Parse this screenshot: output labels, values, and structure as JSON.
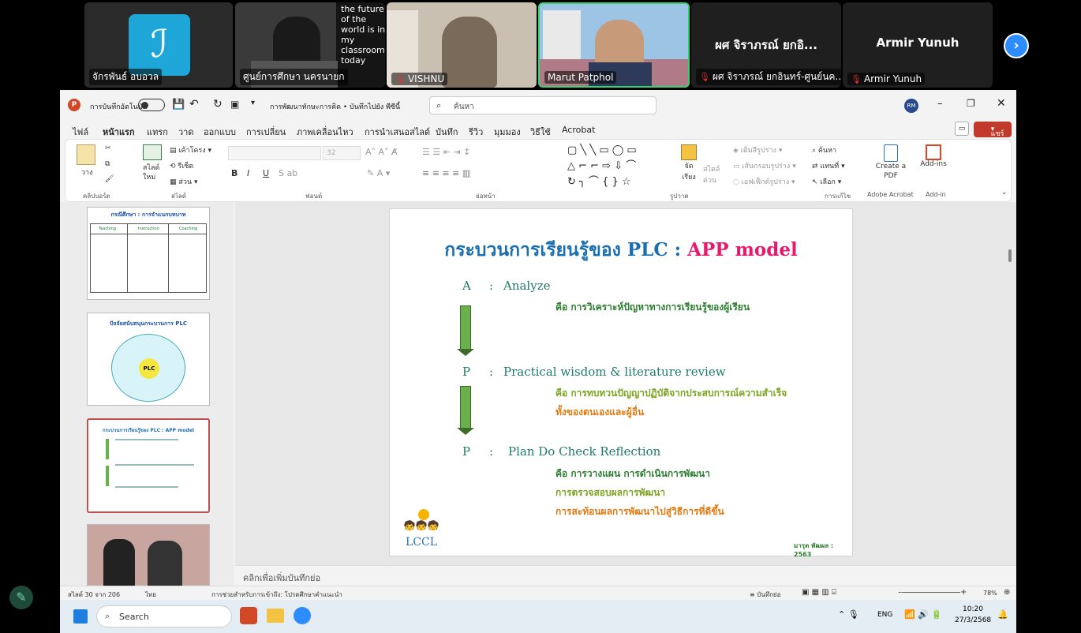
{
  "participants": [
    {
      "name": "จักรพันธ์ อบอวล",
      "muted": false
    },
    {
      "name": "ศูนย์การศึกษา นครนายก",
      "muted": false,
      "background_text": "the future of the world is in my classroom today"
    },
    {
      "name": "VISHNU",
      "muted": true
    },
    {
      "name": "Marut Patphol",
      "muted": false,
      "active": true
    },
    {
      "name": "ผศ จิราภรณ์ ยกอินทร์-ศูนย์นค...",
      "display": "ผศ จิราภรณ์ ยกอิ...",
      "muted": true
    },
    {
      "name": "Armir Yunuh",
      "display": "Armir Yunuh",
      "muted": true
    }
  ],
  "window": {
    "autosave": "การบันทึกอัตโนมัติ",
    "title": "การพัฒนาทักษะการคิด • บันทึกไปยัง พีซีนี้",
    "search_placeholder": "ค้นหา",
    "avatar": "RM",
    "share": "แชร์"
  },
  "menu": [
    "ไฟล์",
    "หน้าแรก",
    "แทรก",
    "วาด",
    "ออกแบบ",
    "การเปลี่ยน",
    "ภาพเคลื่อนไหว",
    "การนำเสนอสไลด์",
    "บันทึก",
    "รีวิว",
    "มุมมอง",
    "วิธีใช้",
    "Acrobat"
  ],
  "ribbon": {
    "paste": "วาง",
    "clipboard": "คลิปบอร์ด",
    "new_slide": "สไลด์ใหม่",
    "layout": "เค้าโครง",
    "reset": "รีเซ็ต",
    "section": "ส่วน",
    "slides_group": "สไลด์",
    "font_size": "32",
    "font_group": "ฟอนต์",
    "paragraph_group": "ย่อหน้า",
    "arrange": "จัดเรียง",
    "quick_styles": "สไตล์ด่วน",
    "fill": "เติมสีรูปร่าง",
    "outline": "เส้นกรอบรูปร่าง",
    "effects": "เอฟเฟ็กต์รูปร่าง",
    "drawing_group": "รูปวาด",
    "find": "ค้นหา",
    "replace": "แทนที่",
    "select": "เลือก",
    "editing_group": "การแก้ไข",
    "create_pdf": "Create a PDF",
    "acrobat_group": "Adobe Acrobat",
    "addins": "Add-ins",
    "addin_group": "Add-in"
  },
  "thumbs": [
    {
      "title": "กรณีศึกษา : การจำแนกบทบาท",
      "cols": [
        "Teaching",
        "Instruction",
        "Coaching"
      ]
    },
    {
      "title": "ปัจจัยสนับสนุนกระบวนการ PLC",
      "center": "PLC"
    },
    {
      "title": "กระบวนการเรียนรู้ของ PLC : APP model"
    },
    {
      "title": ""
    }
  ],
  "slide": {
    "title_main": "กระบวนการเรียนรู้ของ PLC  : ",
    "title_accent": "APP model",
    "items": [
      {
        "letter": "A",
        "colon": ":",
        "label": "Analyze",
        "lines": [
          "คือ การวิเคราะห์ปัญหาทางการเรียนรู้ของผู้เรียน"
        ]
      },
      {
        "letter": "P",
        "colon": ":",
        "label": "Practical wisdom & literature review",
        "lines": [
          "คือ การทบทวนปัญญาปฏิบัติจากประสบการณ์ความสำเร็จ",
          "ทั้งของตนเองและผู้อื่น"
        ]
      },
      {
        "letter": "P",
        "colon": ":",
        "label": "Plan  Do  Check  Reflection",
        "lines": [
          "คือ การวางแผน  การดำเนินการพัฒนา",
          "การตรวจสอบผลการพัฒนา",
          "การสะท้อนผลการพัฒนาไปสู่วิธีการที่ดีขึ้น"
        ]
      }
    ],
    "logo": "LCCL",
    "credit": "มารุต พัฒผล : 2563"
  },
  "notes_placeholder": "คลิกเพื่อเพิ่มบันทึกย่อ",
  "status": {
    "slide": "สไลด์ 30 จาก 206",
    "lang": "ไทย",
    "access": "การช่วยสำหรับการเข้าถึง: โปรดศึกษาคำแนะนำ",
    "notes": "บันทึกย่อ",
    "zoom": "78%"
  },
  "taskbar": {
    "search": "Search",
    "lang": "ENG",
    "time": "10:20",
    "date": "27/3/2568"
  }
}
